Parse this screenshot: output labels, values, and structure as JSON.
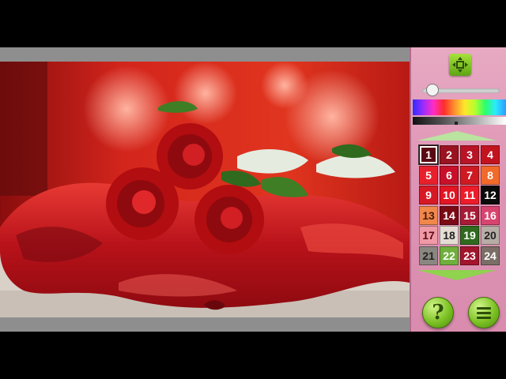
{
  "artwork": {
    "subject": "red roses on red satin",
    "colors": {
      "background": "#c8201b",
      "glow": "#ff7a5a",
      "satin": "#c9161a",
      "rose": "#b20d10",
      "leaf": "#2f6a1e",
      "floor": "#d9d0c8"
    }
  },
  "zoom": {
    "icon": "zoom-fit-icon"
  },
  "brightness_level": 0.12,
  "palette": {
    "selected": "1",
    "swatches": [
      {
        "label": "1",
        "color": "#5a0a13",
        "text": "#ffffff"
      },
      {
        "label": "2",
        "color": "#9a1320",
        "text": "#ffffff"
      },
      {
        "label": "3",
        "color": "#b81426",
        "text": "#ffffff"
      },
      {
        "label": "4",
        "color": "#c2141f",
        "text": "#ffffff"
      },
      {
        "label": "5",
        "color": "#e8202c",
        "text": "#ffffff"
      },
      {
        "label": "6",
        "color": "#c8102a",
        "text": "#ffffff"
      },
      {
        "label": "7",
        "color": "#cf1a22",
        "text": "#ffffff"
      },
      {
        "label": "8",
        "color": "#f26a2a",
        "text": "#ffffff"
      },
      {
        "label": "9",
        "color": "#d61a25",
        "text": "#ffffff"
      },
      {
        "label": "10",
        "color": "#e21522",
        "text": "#ffffff"
      },
      {
        "label": "11",
        "color": "#ee1b2a",
        "text": "#ffffff"
      },
      {
        "label": "12",
        "color": "#0a0a0a",
        "text": "#ffffff"
      },
      {
        "label": "13",
        "color": "#f0884a",
        "text": "#4a1a0a"
      },
      {
        "label": "14",
        "color": "#7a0a14",
        "text": "#ffffff"
      },
      {
        "label": "15",
        "color": "#a81a35",
        "text": "#ffffff"
      },
      {
        "label": "16",
        "color": "#d84470",
        "text": "#ffffff"
      },
      {
        "label": "17",
        "color": "#ef9aa6",
        "text": "#5a0a13"
      },
      {
        "label": "18",
        "color": "#e4ddd4",
        "text": "#222222"
      },
      {
        "label": "19",
        "color": "#2f6a1e",
        "text": "#ffffff"
      },
      {
        "label": "20",
        "color": "#b7ada6",
        "text": "#222222"
      },
      {
        "label": "21",
        "color": "#8a8680",
        "text": "#222222"
      },
      {
        "label": "22",
        "color": "#6fb03c",
        "text": "#ffffff"
      },
      {
        "label": "23",
        "color": "#a2152c",
        "text": "#ffffff"
      },
      {
        "label": "24",
        "color": "#7a6e66",
        "text": "#ffffff"
      }
    ]
  },
  "buttons": {
    "help_glyph": "?",
    "help_icon": "help-icon",
    "menu_icon": "menu-icon"
  },
  "accent_color": "#7cc224"
}
